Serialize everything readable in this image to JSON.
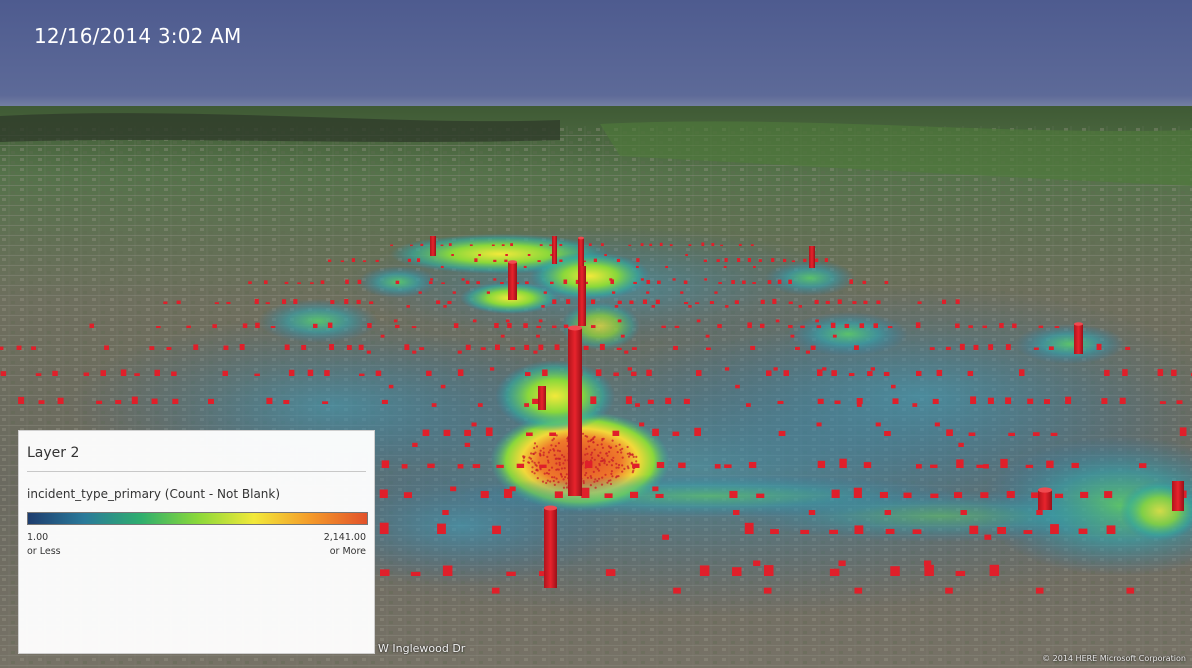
{
  "map": {
    "timestamp": "12/16/2014 3:02 AM",
    "street_label": "W Inglewood Dr",
    "copyright": "© 2014 HERE  Microsoft Corporation"
  },
  "legend": {
    "title": "Layer 2",
    "field": "incident_type_primary (Count - Not Blank)",
    "min_value": "1.00",
    "min_note": "or Less",
    "max_value": "2,141.00",
    "max_note": "or More",
    "ramp_colors": [
      "#1e3d6e",
      "#2a7a9a",
      "#2fae6e",
      "#8ad83a",
      "#f2e93a",
      "#f49a2a",
      "#e2522a"
    ]
  },
  "colors": {
    "sky": "#5d6a98",
    "column": "#e01f2a"
  }
}
